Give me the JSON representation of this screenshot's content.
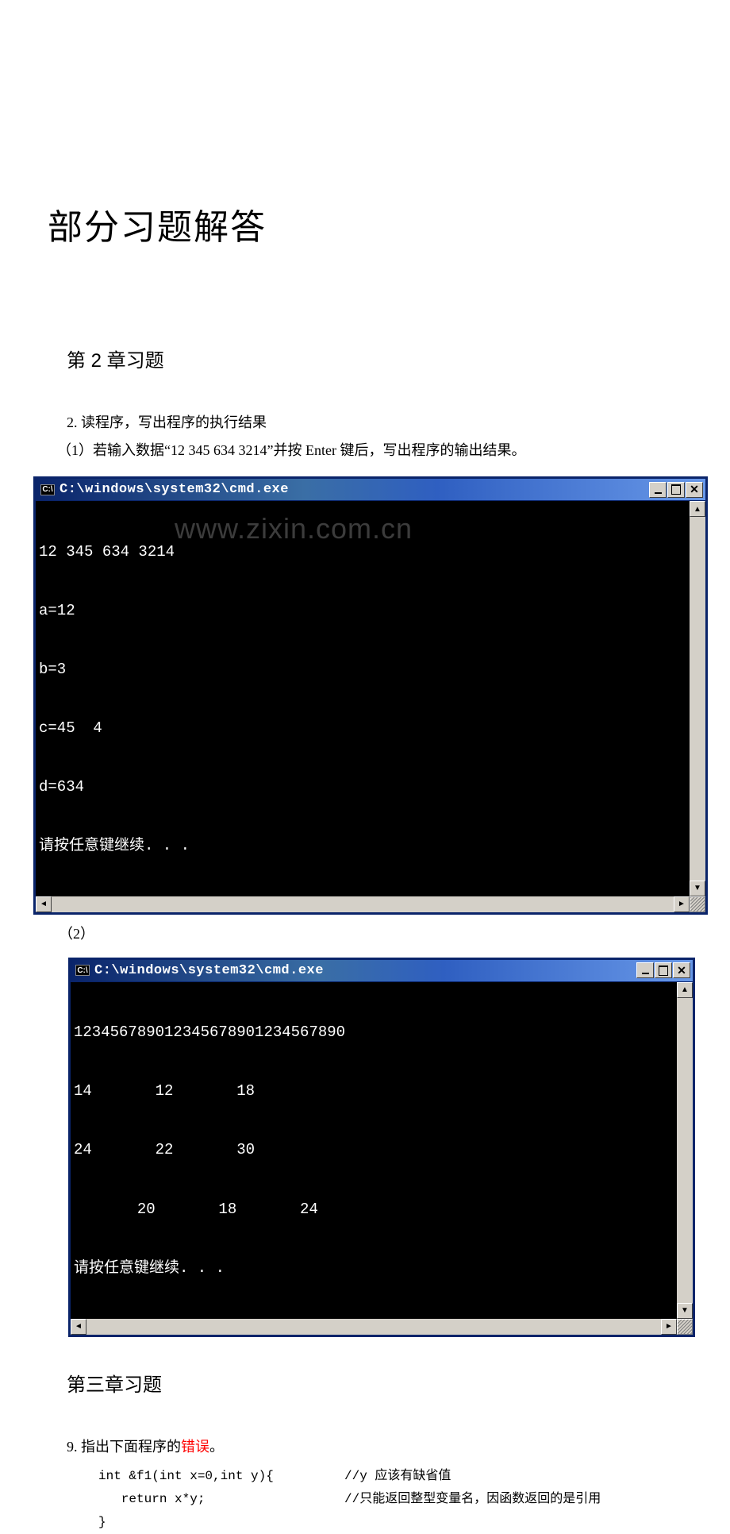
{
  "watermark": "www.zixin.com.cn",
  "main_title": "部分习题解答",
  "section2": {
    "title": "第 2 章习题",
    "q2_intro": "2. 读程序，写出程序的执行结果",
    "q2_1": "（1）若输入数据“12 345 634 3214”并按 Enter 键后，写出程序的输出结果。",
    "label_2": "（2）",
    "cmd_title": "C:\\windows\\system32\\cmd.exe",
    "cmd_icon": "C:\\",
    "term1": [
      "12 345 634 3214",
      "a=12",
      "b=3",
      "c=45  4",
      "d=634",
      "请按任意键继续. . ."
    ],
    "term2": [
      "123456789012345678901234567890",
      "14       12       18",
      "24       22       30",
      "       20       18       24",
      "请按任意键继续. . ."
    ]
  },
  "section3": {
    "title": "第三章习题",
    "q9_pre": "9. 指出下面程序的",
    "q9_err": "错误",
    "q9_post": "。",
    "code": {
      "l1": "int &f1(int x=0,int y){",
      "c1": "//y 应该有缺省值",
      "l2": "   return x*y;",
      "c2": "//只能返回整型变量名，因函数返回的是引用",
      "l3": "}"
    }
  }
}
